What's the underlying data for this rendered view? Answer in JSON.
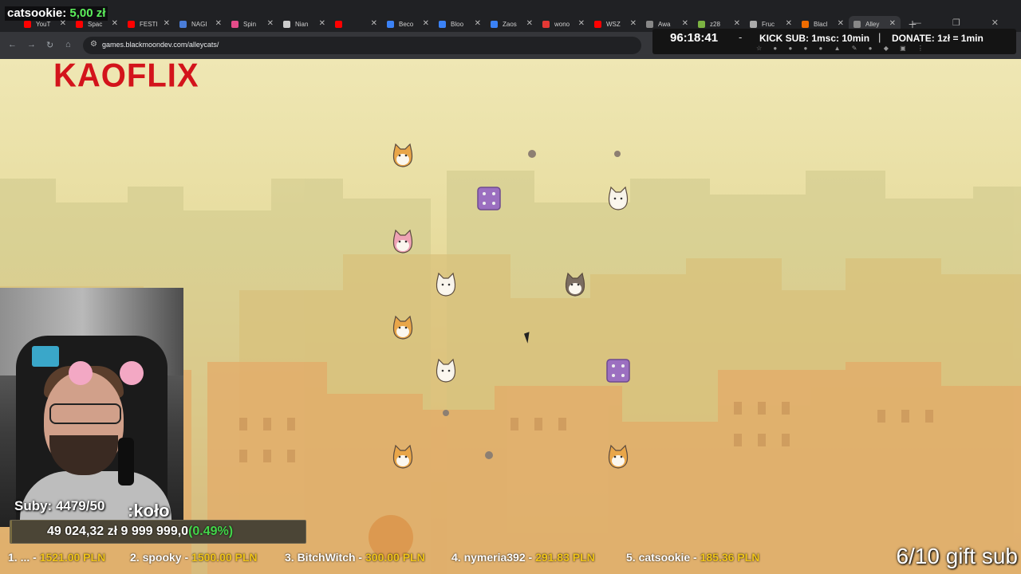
{
  "donation": {
    "name": "catsookie:",
    "amount": "5,00 zł"
  },
  "tabs": [
    {
      "title": "YouT",
      "color": "#ff0000"
    },
    {
      "title": "Spac",
      "color": "#ff0000"
    },
    {
      "title": "FESTI",
      "color": "#ff0000"
    },
    {
      "title": "NAGI",
      "color": "#4a7dd8"
    },
    {
      "title": "Spin",
      "color": "#e44c8a"
    },
    {
      "title": "Nian",
      "color": "#cccccc"
    },
    {
      "title": "",
      "color": "#ff0000"
    },
    {
      "title": "Beco",
      "color": "#3b82f6"
    },
    {
      "title": "Bloo",
      "color": "#3b82f6"
    },
    {
      "title": "Zaos",
      "color": "#3b82f6"
    },
    {
      "title": "wono",
      "color": "#e53935"
    },
    {
      "title": "WSZ",
      "color": "#ff0000"
    },
    {
      "title": "Awa",
      "color": "#888888"
    },
    {
      "title": "z28",
      "color": "#7cb342"
    },
    {
      "title": "Fruc",
      "color": "#aaaaaa"
    },
    {
      "title": "Blacl",
      "color": "#ef6c00"
    },
    {
      "title": "Alley",
      "color": "#888888",
      "active": true
    }
  ],
  "address": {
    "url": "games.blackmoondev.com/alleycats/"
  },
  "overlay": {
    "timer": "96:18:41",
    "kick": "KICK SUB: 1msc: 10min",
    "donate": "DONATE: 1zł = 1min"
  },
  "brand": "KAOFLIX",
  "stream": {
    "subs": "Suby: 4479/50",
    "kolo": ":koło",
    "goal_current": "49 024,32 zł",
    "goal_target": "9 999 999,0",
    "goal_percent": "(0.49%)",
    "goal_fill": 0.0049,
    "gift": "6/10 gift sub"
  },
  "ticker": [
    {
      "label": "1. ... -",
      "amount": "1521.00 PLN"
    },
    {
      "label": "2. spooky -",
      "amount": "1500.00 PLN"
    },
    {
      "label": "3. BitchWitch -",
      "amount": "300.00 PLN"
    },
    {
      "label": "4. nymeria392 -",
      "amount": "291.83 PLN"
    },
    {
      "label": "5. catsookie -",
      "amount": "185.36 PLN"
    }
  ],
  "game": {
    "pieces": [
      {
        "kind": "orange-cat",
        "color": "#e9a649"
      },
      {
        "kind": "purple-box",
        "color": "#9b6fc0"
      },
      {
        "kind": "pink-cat",
        "color": "#eea3b5"
      },
      {
        "kind": "calico-cat",
        "color": "#f7f3ea"
      },
      {
        "kind": "gray-cat",
        "color": "#7b6d61"
      },
      {
        "kind": "orange-cat",
        "color": "#e9a649"
      },
      {
        "kind": "white-cat",
        "color": "#f7f3ea"
      },
      {
        "kind": "purple-box",
        "color": "#9b6fc0"
      },
      {
        "kind": "orange-cat",
        "color": "#e9a649"
      },
      {
        "kind": "orange-cat",
        "color": "#e9a649"
      },
      {
        "kind": "white-cat",
        "color": "#f7f3ea"
      }
    ]
  }
}
